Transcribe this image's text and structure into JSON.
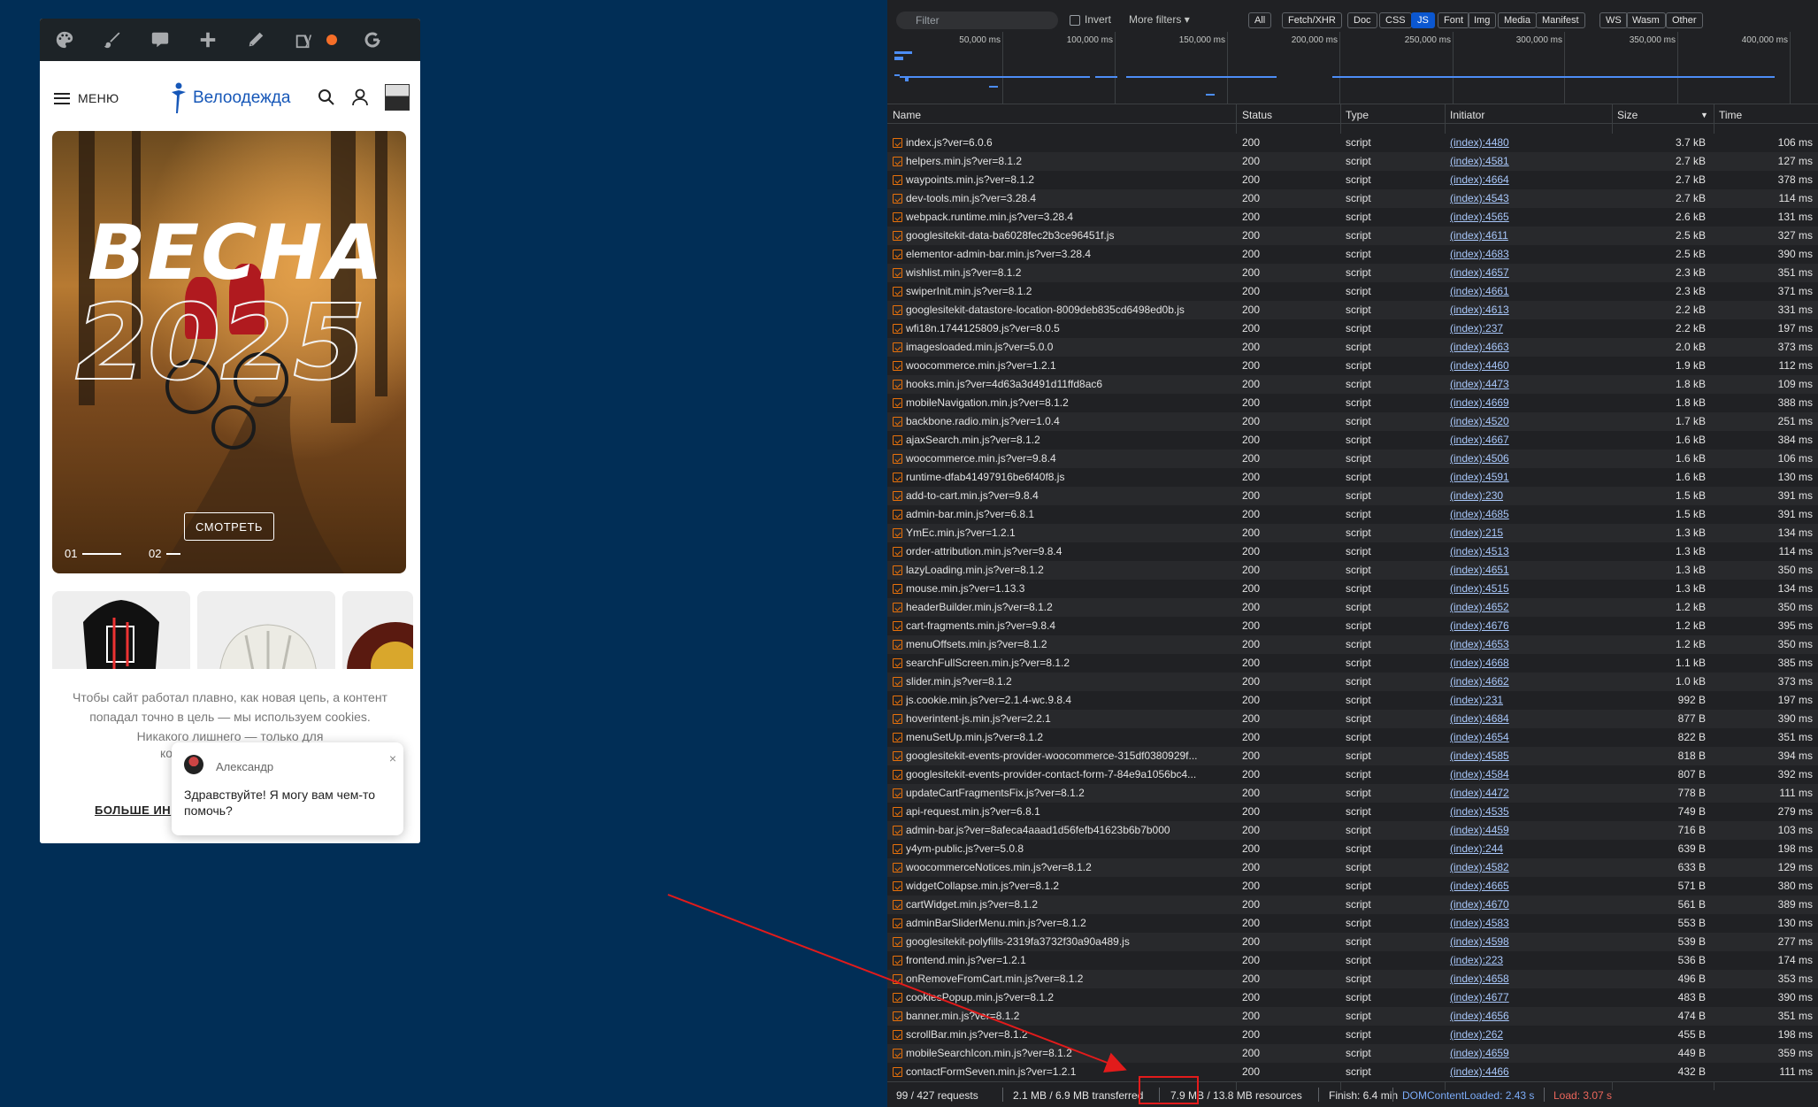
{
  "mobile": {
    "menu_label": "МЕНЮ",
    "logo_text": "Велоодежда",
    "hero": {
      "title": "ВЕСНА",
      "year": "2025",
      "button": "СМОТРЕТЬ",
      "slide1": "01",
      "slide2": "02"
    },
    "cookie": {
      "text": "Чтобы сайт работал плавно, как новая цепь, а контент попадал точно в цель — мы используем cookies. Никакого лишнего — только для",
      "fragment": "ко",
      "more": "БОЛЬШЕ ИН"
    },
    "chat": {
      "name": "Александр",
      "message": "Здравствуйте! Я могу вам чем-то помочь?",
      "close": "×"
    }
  },
  "devtools": {
    "filter_placeholder": "Filter",
    "invert_label": "Invert",
    "more_filters": "More filters",
    "chips": [
      "All",
      "Fetch/XHR",
      "Doc",
      "CSS",
      "JS",
      "Font",
      "Img",
      "Media",
      "Manifest",
      "WS",
      "Wasm",
      "Other"
    ],
    "active_chip": "JS",
    "timeline_ticks": [
      "50,000 ms",
      "100,000 ms",
      "150,000 ms",
      "200,000 ms",
      "250,000 ms",
      "300,000 ms",
      "350,000 ms",
      "400,000 ms"
    ],
    "columns": {
      "name": "Name",
      "status": "Status",
      "type": "Type",
      "initiator": "Initiator",
      "size": "Size",
      "time": "Time"
    },
    "rows": [
      [
        "index.js?ver=6.0.6",
        "200",
        "script",
        "(index):4480",
        "3.7 kB",
        "106 ms"
      ],
      [
        "helpers.min.js?ver=8.1.2",
        "200",
        "script",
        "(index):4581",
        "2.7 kB",
        "127 ms"
      ],
      [
        "waypoints.min.js?ver=8.1.2",
        "200",
        "script",
        "(index):4664",
        "2.7 kB",
        "378 ms"
      ],
      [
        "dev-tools.min.js?ver=3.28.4",
        "200",
        "script",
        "(index):4543",
        "2.7 kB",
        "114 ms"
      ],
      [
        "webpack.runtime.min.js?ver=3.28.4",
        "200",
        "script",
        "(index):4565",
        "2.6 kB",
        "131 ms"
      ],
      [
        "googlesitekit-data-ba6028fec2b3ce96451f.js",
        "200",
        "script",
        "(index):4611",
        "2.5 kB",
        "327 ms"
      ],
      [
        "elementor-admin-bar.min.js?ver=3.28.4",
        "200",
        "script",
        "(index):4683",
        "2.5 kB",
        "390 ms"
      ],
      [
        "wishlist.min.js?ver=8.1.2",
        "200",
        "script",
        "(index):4657",
        "2.3 kB",
        "351 ms"
      ],
      [
        "swiperInit.min.js?ver=8.1.2",
        "200",
        "script",
        "(index):4661",
        "2.3 kB",
        "371 ms"
      ],
      [
        "googlesitekit-datastore-location-8009deb835cd6498ed0b.js",
        "200",
        "script",
        "(index):4613",
        "2.2 kB",
        "331 ms"
      ],
      [
        "wfi18n.1744125809.js?ver=8.0.5",
        "200",
        "script",
        "(index):237",
        "2.2 kB",
        "197 ms"
      ],
      [
        "imagesloaded.min.js?ver=5.0.0",
        "200",
        "script",
        "(index):4663",
        "2.0 kB",
        "373 ms"
      ],
      [
        "woocommerce.min.js?ver=1.2.1",
        "200",
        "script",
        "(index):4460",
        "1.9 kB",
        "112 ms"
      ],
      [
        "hooks.min.js?ver=4d63a3d491d11ffd8ac6",
        "200",
        "script",
        "(index):4473",
        "1.8 kB",
        "109 ms"
      ],
      [
        "mobileNavigation.min.js?ver=8.1.2",
        "200",
        "script",
        "(index):4669",
        "1.8 kB",
        "388 ms"
      ],
      [
        "backbone.radio.min.js?ver=1.0.4",
        "200",
        "script",
        "(index):4520",
        "1.7 kB",
        "251 ms"
      ],
      [
        "ajaxSearch.min.js?ver=8.1.2",
        "200",
        "script",
        "(index):4667",
        "1.6 kB",
        "384 ms"
      ],
      [
        "woocommerce.min.js?ver=9.8.4",
        "200",
        "script",
        "(index):4506",
        "1.6 kB",
        "106 ms"
      ],
      [
        "runtime-dfab41497916be6f40f8.js",
        "200",
        "script",
        "(index):4591",
        "1.6 kB",
        "130 ms"
      ],
      [
        "add-to-cart.min.js?ver=9.8.4",
        "200",
        "script",
        "(index):230",
        "1.5 kB",
        "391 ms"
      ],
      [
        "admin-bar.min.js?ver=6.8.1",
        "200",
        "script",
        "(index):4685",
        "1.5 kB",
        "391 ms"
      ],
      [
        "YmEc.min.js?ver=1.2.1",
        "200",
        "script",
        "(index):215",
        "1.3 kB",
        "134 ms"
      ],
      [
        "order-attribution.min.js?ver=9.8.4",
        "200",
        "script",
        "(index):4513",
        "1.3 kB",
        "114 ms"
      ],
      [
        "lazyLoading.min.js?ver=8.1.2",
        "200",
        "script",
        "(index):4651",
        "1.3 kB",
        "350 ms"
      ],
      [
        "mouse.min.js?ver=1.13.3",
        "200",
        "script",
        "(index):4515",
        "1.3 kB",
        "134 ms"
      ],
      [
        "headerBuilder.min.js?ver=8.1.2",
        "200",
        "script",
        "(index):4652",
        "1.2 kB",
        "350 ms"
      ],
      [
        "cart-fragments.min.js?ver=9.8.4",
        "200",
        "script",
        "(index):4676",
        "1.2 kB",
        "395 ms"
      ],
      [
        "menuOffsets.min.js?ver=8.1.2",
        "200",
        "script",
        "(index):4653",
        "1.2 kB",
        "350 ms"
      ],
      [
        "searchFullScreen.min.js?ver=8.1.2",
        "200",
        "script",
        "(index):4668",
        "1.1 kB",
        "385 ms"
      ],
      [
        "slider.min.js?ver=8.1.2",
        "200",
        "script",
        "(index):4662",
        "1.0 kB",
        "373 ms"
      ],
      [
        "js.cookie.min.js?ver=2.1.4-wc.9.8.4",
        "200",
        "script",
        "(index):231",
        "992 B",
        "197 ms"
      ],
      [
        "hoverintent-js.min.js?ver=2.2.1",
        "200",
        "script",
        "(index):4684",
        "877 B",
        "390 ms"
      ],
      [
        "menuSetUp.min.js?ver=8.1.2",
        "200",
        "script",
        "(index):4654",
        "822 B",
        "351 ms"
      ],
      [
        "googlesitekit-events-provider-woocommerce-315df0380929f...",
        "200",
        "script",
        "(index):4585",
        "818 B",
        "394 ms"
      ],
      [
        "googlesitekit-events-provider-contact-form-7-84e9a1056bc4...",
        "200",
        "script",
        "(index):4584",
        "807 B",
        "392 ms"
      ],
      [
        "updateCartFragmentsFix.js?ver=8.1.2",
        "200",
        "script",
        "(index):4472",
        "778 B",
        "111 ms"
      ],
      [
        "api-request.min.js?ver=6.8.1",
        "200",
        "script",
        "(index):4535",
        "749 B",
        "279 ms"
      ],
      [
        "admin-bar.js?ver=8afeca4aaad1d56fefb41623b6b7b000",
        "200",
        "script",
        "(index):4459",
        "716 B",
        "103 ms"
      ],
      [
        "y4ym-public.js?ver=5.0.8",
        "200",
        "script",
        "(index):244",
        "639 B",
        "198 ms"
      ],
      [
        "woocommerceNotices.min.js?ver=8.1.2",
        "200",
        "script",
        "(index):4582",
        "633 B",
        "129 ms"
      ],
      [
        "widgetCollapse.min.js?ver=8.1.2",
        "200",
        "script",
        "(index):4665",
        "571 B",
        "380 ms"
      ],
      [
        "cartWidget.min.js?ver=8.1.2",
        "200",
        "script",
        "(index):4670",
        "561 B",
        "389 ms"
      ],
      [
        "adminBarSliderMenu.min.js?ver=8.1.2",
        "200",
        "script",
        "(index):4583",
        "553 B",
        "130 ms"
      ],
      [
        "googlesitekit-polyfills-2319fa3732f30a90a489.js",
        "200",
        "script",
        "(index):4598",
        "539 B",
        "277 ms"
      ],
      [
        "frontend.min.js?ver=1.2.1",
        "200",
        "script",
        "(index):223",
        "536 B",
        "174 ms"
      ],
      [
        "onRemoveFromCart.min.js?ver=8.1.2",
        "200",
        "script",
        "(index):4658",
        "496 B",
        "353 ms"
      ],
      [
        "cookiesPopup.min.js?ver=8.1.2",
        "200",
        "script",
        "(index):4677",
        "483 B",
        "390 ms"
      ],
      [
        "banner.min.js?ver=8.1.2",
        "200",
        "script",
        "(index):4656",
        "474 B",
        "351 ms"
      ],
      [
        "scrollBar.min.js?ver=8.1.2",
        "200",
        "script",
        "(index):262",
        "455 B",
        "198 ms"
      ],
      [
        "mobileSearchIcon.min.js?ver=8.1.2",
        "200",
        "script",
        "(index):4659",
        "449 B",
        "359 ms"
      ],
      [
        "contactFormSeven.min.js?ver=1.2.1",
        "200",
        "script",
        "(index):4466",
        "432 B",
        "111 ms"
      ]
    ],
    "status_bar": {
      "requests": "99 / 427 requests",
      "transferred": "2.1 MB / 6.9 MB transferred",
      "resources": "7.9 MB / 13.8 MB resources",
      "finish": "Finish: 6.4 min",
      "dcl": "DOMContentLoaded: 2.43 s",
      "load": "Load: 3.07 s"
    }
  },
  "colors": {
    "page_bg": "#012e56",
    "devtools_bg": "#202124",
    "link": "#a8c7fa",
    "brand_blue": "#1657b8",
    "annotation_red": "#e21b1b"
  }
}
